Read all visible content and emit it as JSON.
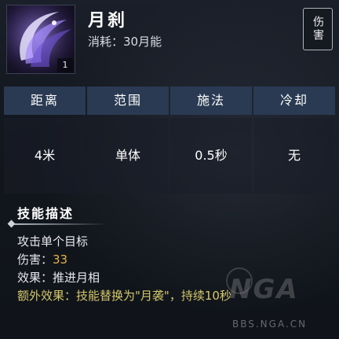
{
  "skill": {
    "name": "月刹",
    "cost_label": "消耗：",
    "cost_value": "30月能",
    "level": "1",
    "type_tag": "伤害",
    "icon": "crescent-slash-icon"
  },
  "stats": {
    "headers": [
      "距离",
      "范围",
      "施法",
      "冷却"
    ],
    "values": [
      "4米",
      "单体",
      "0.5秒",
      "无"
    ]
  },
  "description": {
    "title": "技能描述",
    "line1": "攻击单个目标",
    "damage_label": "伤害：",
    "damage_value": "33",
    "effect_label": "效果：",
    "effect_value": "推进月相",
    "extra_label": "额外效果：",
    "extra_value": "技能替换为\"月袭\"，持续10秒"
  },
  "watermark": {
    "logo": "NGA",
    "url": "BBS.NGA.CN"
  },
  "colors": {
    "header_bg": "#2a3a52",
    "damage_value": "#e4b34a",
    "extra_effect": "#d4c86a"
  }
}
